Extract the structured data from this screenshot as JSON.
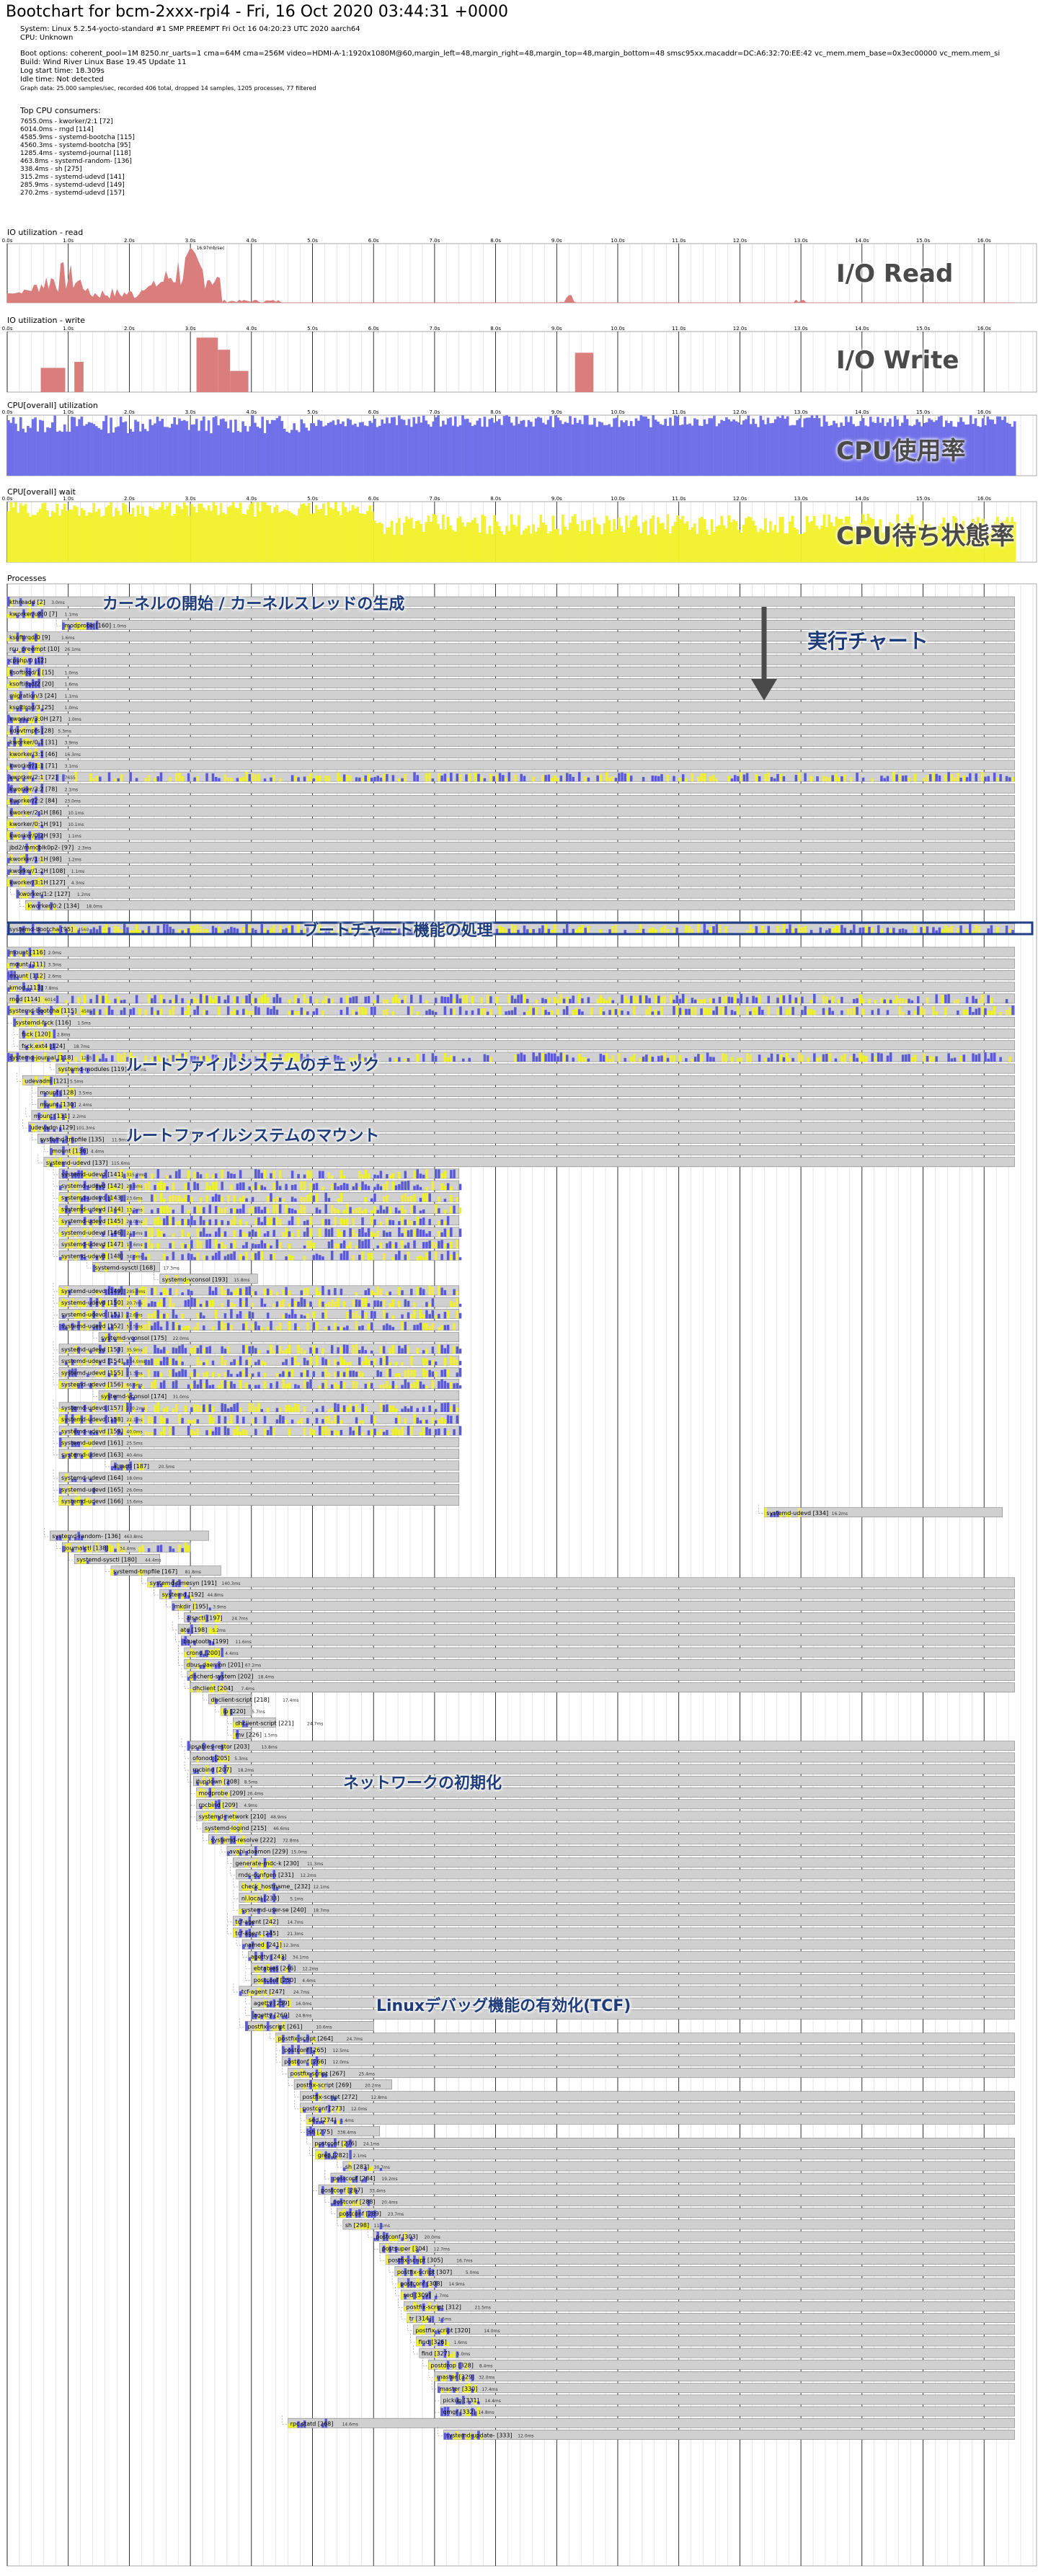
{
  "header": {
    "title": "Bootchart for bcm-2xxx-rpi4 - Fri, 16 Oct 2020 03:44:31 +0000",
    "system": "System: Linux 5.2.54-yocto-standard #1 SMP PREEMPT Fri Oct 16 04:20:23 UTC 2020 aarch64",
    "cpu": "CPU: Unknown",
    "boot_options": "Boot options: coherent_pool=1M 8250.nr_uarts=1 cma=64M cma=256M video=HDMI-A-1:1920x1080M@60,margin_left=48,margin_right=48,margin_top=48,margin_bottom=48 smsc95xx.macaddr=DC:A6:32:70:EE:42 vc_mem.mem_base=0x3ec00000 vc_mem.mem_si",
    "build": "Build: Wind River Linux Base 19.45 Update 11",
    "log_start": "Log start time: 18.309s",
    "idle_time": "Idle time: Not detected",
    "graph_data": "Graph data: 25.000 samples/sec, recorded 406 total, dropped 14 samples, 1205 processes, 77 filtered"
  },
  "top_cpu": {
    "title": "Top CPU consumers:",
    "lines": [
      "7655.0ms - kworker/2:1 [72]",
      "6014.0ms - rngd [114]",
      "4585.9ms - systemd-bootcha [115]",
      "4560.3ms - systemd-bootcha [95]",
      "1285.4ms - systemd-journal [118]",
      "463.8ms - systemd-random- [136]",
      "338.4ms - sh [275]",
      "315.2ms - systemd-udevd [141]",
      "285.9ms - systemd-udevd [149]",
      "270.2ms - systemd-udevd [157]"
    ]
  },
  "time_axis": [
    "0.0s",
    "1.0s",
    "2.0s",
    "3.0s",
    "4.0s",
    "5.0s",
    "6.0s",
    "7.0s",
    "8.0s",
    "9.0s",
    "10.0s",
    "11.0s",
    "12.0s",
    "13.0s",
    "14.0s",
    "15.0s",
    "16.0s"
  ],
  "charts": {
    "io_read": {
      "title": "IO utilization - read",
      "overlay": "I/O Read",
      "peak": "16.97mb/sec"
    },
    "io_write": {
      "title": "IO utilization - write",
      "overlay": "I/O Write"
    },
    "cpu_util": {
      "title": "CPU[overall] utilization",
      "overlay": "CPU使用率"
    },
    "cpu_wait": {
      "title": "CPU[overall] wait",
      "overlay": "CPU待ち状態率"
    }
  },
  "colors": {
    "io": "#d97d7d",
    "cpu": "#7070e8",
    "wait": "#f2f232",
    "proc_bg": "#d0d0d0",
    "proc_border": "#808080",
    "proc_cpu": "#5a5ad8",
    "proc_wait": "#f0f030",
    "annot": "#1f3c7a",
    "box": "#1e3f8a"
  },
  "processes_title": "Processes",
  "annotations": {
    "kernel": "カーネルの開始 / カーネルスレッドの生成",
    "exec_chart": "実行チャート",
    "bootchart": "ブートチャート機能の処理",
    "fscheck": "ルートファイルシステムのチェック",
    "mount": "ルートファイルシステムのマウント",
    "network": "ネットワークの初期化",
    "tcf": "Linuxデバッグ機能の有効化(TCF)"
  },
  "processes": [
    [
      "kthreadd [2]",
      0.0,
      16.5,
      "3.0ms"
    ],
    [
      "kworker/u8:0 [7]",
      0.0,
      16.5,
      "1.1ms"
    ],
    [
      "modprobe [160]",
      0.9,
      16.5,
      "1.0ms"
    ],
    [
      "ksoftirqd/0 [9]",
      0.0,
      16.5,
      "1.6ms"
    ],
    [
      "rcu_preempt [10]",
      0.0,
      16.5,
      "26.1ms"
    ],
    [
      "cpuhp/0 [12]",
      0.0,
      16.5,
      ""
    ],
    [
      "ksoftirqd/1 [15]",
      0.0,
      16.5,
      "1.0ms"
    ],
    [
      "ksoftirqd/2 [20]",
      0.0,
      16.5,
      "1.6ms"
    ],
    [
      "migration/3 [24]",
      0.0,
      16.5,
      "1.1ms"
    ],
    [
      "ksoftirqd/3 [25]",
      0.0,
      16.5,
      "1.0ms"
    ],
    [
      "kworker/3:0H [27]",
      0.0,
      16.5,
      "1.0ms"
    ],
    [
      "kdevtmpfs [28]",
      0.0,
      16.5,
      "5.3ms"
    ],
    [
      "kworker/0:1 [31]",
      0.0,
      16.5,
      "3.9ms"
    ],
    [
      "kworker/3:1 [46]",
      0.0,
      16.5,
      "16.3ms"
    ],
    [
      "kworker/1:1 [71]",
      0.0,
      16.5,
      "3.1ms"
    ],
    [
      "kworker/2:1 [72]",
      0.0,
      16.5,
      "7655"
    ],
    [
      "kworker/3:2 [78]",
      0.0,
      16.5,
      "2.1ms"
    ],
    [
      "kworker/2:2 [84]",
      0.0,
      16.5,
      "23.0ms"
    ],
    [
      "kworker/2:1H [86]",
      0.0,
      16.5,
      "10.1ms"
    ],
    [
      "kworker/0:1H [91]",
      0.0,
      16.5,
      "10.1ms"
    ],
    [
      "kworker/0:2H [93]",
      0.0,
      16.5,
      "1.1ms"
    ],
    [
      "jbd2/mmcblk0p2- [97]",
      0.0,
      16.5,
      "2.3ms"
    ],
    [
      "kworker/1:1H [98]",
      0.0,
      16.5,
      "1.2ms"
    ],
    [
      "kworker/1:2H [108]",
      0.0,
      16.5,
      "1.1ms"
    ],
    [
      "kworker/3:1H [127]",
      0.0,
      16.5,
      "4.3ms"
    ],
    [
      "kworker/1:2 [127]",
      0.15,
      16.5,
      "1.2ms"
    ],
    [
      "kworker/0:2 [134]",
      0.3,
      16.5,
      "18.0ms"
    ],
    [
      "",
      0,
      0,
      ""
    ],
    [
      "systemd-bootcha [95]",
      0.0,
      16.5,
      "4560"
    ],
    [
      "",
      0,
      0,
      ""
    ],
    [
      "mount [116]",
      0.0,
      16.5,
      "2.0ms"
    ],
    [
      "mount [111]",
      0.0,
      16.5,
      "3.3ms"
    ],
    [
      "mount [112]",
      0.0,
      16.5,
      "2.6ms"
    ],
    [
      "kmod [113]",
      0.0,
      16.5,
      "7.8ms"
    ],
    [
      "rngd [114]",
      0.0,
      16.5,
      "6014"
    ],
    [
      "systemd-bootcha [115]",
      0.0,
      16.5,
      "4585"
    ],
    [
      "systemd-fsck [116]",
      0.1,
      16.5,
      "1.5ms"
    ],
    [
      "fsck [120]",
      0.2,
      16.5,
      "2.8ms"
    ],
    [
      "fsck.ext4 [124]",
      0.2,
      16.5,
      "18.7ms"
    ],
    [
      "systemd-journal [118]",
      0.0,
      16.5,
      "1285"
    ],
    [
      "systemd-modules [119]",
      0.8,
      16.5,
      "14.9ms"
    ],
    [
      "udevadm [121]",
      0.25,
      16.5,
      "5.5ms"
    ],
    [
      "mount [128]",
      0.5,
      16.5,
      "3.5ms"
    ],
    [
      "mount [130]",
      0.5,
      16.5,
      "2.4ms"
    ],
    [
      "mount [131]",
      0.4,
      16.5,
      "2.2ms"
    ],
    [
      "udevadm [129]",
      0.35,
      16.5,
      "101.3ms"
    ],
    [
      "systemd-tmpfile [135]",
      0.5,
      16.5,
      "11.9ms"
    ],
    [
      "mount [136]",
      0.7,
      16.5,
      "4.4ms"
    ],
    [
      "systemd-udevd [137]",
      0.6,
      16.5,
      "115.6ms"
    ],
    [
      "systemd-udevd [141]",
      0.85,
      7.4,
      "315.2ms"
    ],
    [
      "systemd-udevd [142]",
      0.85,
      7.4,
      "26.8ms"
    ],
    [
      "systemd-udevd [143]",
      0.85,
      7.4,
      "23.6ms"
    ],
    [
      "systemd-udevd [144]",
      0.85,
      7.4,
      "13.5ms"
    ],
    [
      "systemd-udevd [145]",
      0.85,
      7.4,
      "20.0ms"
    ],
    [
      "systemd-udevd [146]",
      0.85,
      7.4,
      "21.5ms"
    ],
    [
      "systemd-udevd [147]",
      0.85,
      7.4,
      "17.6ms"
    ],
    [
      "systemd-udevd [148]",
      0.85,
      7.4,
      "34.0ms"
    ],
    [
      "systemd-sysctl [168]",
      1.4,
      2.5,
      "17.3ms"
    ],
    [
      "systemd-vconsol [193]",
      2.5,
      4.1,
      "15.8ms"
    ],
    [
      "systemd-udevd [149]",
      0.85,
      7.4,
      "285.9ms"
    ],
    [
      "systemd-udevd [150]",
      0.85,
      7.4,
      "20.7ms"
    ],
    [
      "systemd-udevd [151]",
      0.85,
      7.4,
      "22.6ms"
    ],
    [
      "systemd-udevd [152]",
      0.85,
      7.4,
      "57.5ms"
    ],
    [
      "systemd-vconsol [175]",
      1.5,
      7.4,
      "22.0ms"
    ],
    [
      "systemd-udevd [153]",
      0.85,
      7.4,
      "35.9ms"
    ],
    [
      "systemd-udevd [154]",
      0.85,
      7.4,
      "134.0ms"
    ],
    [
      "systemd-udevd [155]",
      0.85,
      7.4,
      "21.3ms"
    ],
    [
      "systemd-udevd [156]",
      0.85,
      7.4,
      "66.6ms"
    ],
    [
      "systemd-vconsol [174]",
      1.5,
      7.4,
      "31.0ms"
    ],
    [
      "systemd-udevd [157]",
      0.85,
      7.4,
      "270.2ms"
    ],
    [
      "systemd-udevd [158]",
      0.85,
      7.4,
      "22.1ms"
    ],
    [
      "systemd-udevd [159]",
      0.85,
      7.4,
      "40.0ms"
    ],
    [
      "systemd-udevd [161]",
      0.85,
      7.4,
      "25.5ms"
    ],
    [
      "systemd-udevd [163]",
      0.85,
      7.4,
      "40.4ms"
    ],
    [
      "alsactl [187]",
      1.7,
      7.4,
      "20.5ms"
    ],
    [
      "systemd-udevd [164]",
      0.85,
      7.4,
      "18.0ms"
    ],
    [
      "systemd-udevd [165]",
      0.85,
      7.4,
      "26.0ms"
    ],
    [
      "systemd-udevd [166]",
      0.85,
      7.4,
      "15.6ms"
    ],
    [
      "systemd-udevd [334]",
      12.4,
      16.3,
      "16.2ms"
    ],
    [
      "",
      0,
      0,
      ""
    ],
    [
      "systemd-random- [136]",
      0.7,
      3.3,
      "463.8ms"
    ],
    [
      "journalctl [138]",
      0.9,
      3.0,
      "34.4ms"
    ],
    [
      "systemd-sysctl [180]",
      1.1,
      2.5,
      "44.4ms"
    ],
    [
      "systemd-tmpfile [167]",
      1.7,
      3.5,
      "81.8ms"
    ],
    [
      "systemd-timesyn [191]",
      2.3,
      16.5,
      "140.3ms"
    ],
    [
      "systemd [192]",
      2.5,
      16.5,
      "44.8ms"
    ],
    [
      "mkdir [195]",
      2.7,
      16.5,
      "3.9ms"
    ],
    [
      "alsactl [197]",
      2.9,
      16.5,
      "24.7ms"
    ],
    [
      "atd [198]",
      2.8,
      16.5,
      "5.2ms"
    ],
    [
      "bluetooth [199]",
      2.85,
      16.5,
      "11.6ms"
    ],
    [
      "crond [200]",
      2.9,
      16.5,
      "4.4ms"
    ],
    [
      "dbus-daemon [201]",
      2.9,
      16.5,
      "67.2ms"
    ],
    [
      "dhcherd-system [202]",
      2.95,
      16.5,
      "18.4ms"
    ],
    [
      "dhclient [204]",
      3.0,
      16.5,
      "7.4ms"
    ],
    [
      "dhclient-script [218]",
      3.3,
      4.0,
      "17.4ms"
    ],
    [
      "ip [220]",
      3.5,
      4.0,
      "5.7ms"
    ],
    [
      "dhclient-script [221]",
      3.7,
      4.4,
      "24.7ms"
    ],
    [
      "mv [226]",
      3.7,
      4.0,
      "1.5ms"
    ],
    [
      "ipsables-restor [203]",
      2.95,
      16.5,
      "13.8ms"
    ],
    [
      "ofonod [205]",
      3.0,
      16.5,
      "5.3ms"
    ],
    [
      "rpcbind [207]",
      3.0,
      16.5,
      "18.2ms"
    ],
    [
      "ifupdown [208]",
      3.05,
      16.5,
      "8.5ms"
    ],
    [
      "modprobe [209]",
      3.1,
      16.5,
      "26.4ms"
    ],
    [
      "rpcbind [209]",
      3.1,
      16.5,
      "4.9ms"
    ],
    [
      "systemd-network [210]",
      3.1,
      16.5,
      "48.9ms"
    ],
    [
      "systemd-logind [215]",
      3.2,
      16.5,
      "46.6ms"
    ],
    [
      "systemd-resolve [222]",
      3.3,
      16.5,
      "72.8ms"
    ],
    [
      "avahi-daemon [229]",
      3.6,
      16.5,
      "15.0ms"
    ],
    [
      "generate-rndc-k [230]",
      3.7,
      16.5,
      "11.3ms"
    ],
    [
      "rndc-confgen [231]",
      3.75,
      16.5,
      "12.2ms"
    ],
    [
      "check_hostname_ [232]",
      3.8,
      16.5,
      "12.1ms"
    ],
    [
      "nl.local [233]",
      3.8,
      16.5,
      "5.1ms"
    ],
    [
      "systemd-user-se [240]",
      3.8,
      16.5,
      "18.7ms"
    ],
    [
      "tcf-agent [242]",
      3.7,
      16.5,
      "14.7ms"
    ],
    [
      "tcf-agent [245]",
      3.7,
      16.5,
      "21.3ms"
    ],
    [
      "named [241]",
      3.85,
      16.5,
      "12.3ms"
    ],
    [
      "agetty [243]",
      3.95,
      16.5,
      "34.1ms"
    ],
    [
      "ebtables [246]",
      4.0,
      16.5,
      "12.2ms"
    ],
    [
      "postconf [250]",
      4.0,
      16.5,
      "4.4ms"
    ],
    [
      "tcf-agent [247]",
      3.8,
      16.5,
      "24.7ms"
    ],
    [
      "agetty [259]",
      4.0,
      16.5,
      "16.0ms"
    ],
    [
      "agetty [260]",
      4.0,
      16.5,
      "24.8ms"
    ],
    [
      "postfix-script [261]",
      3.9,
      6.0,
      "10.6ms"
    ],
    [
      "postfix-script [264]",
      4.4,
      16.5,
      "24.7ms"
    ],
    [
      "postconf [265]",
      4.5,
      16.5,
      "12.5ms"
    ],
    [
      "postconf [266]",
      4.5,
      16.5,
      "12.0ms"
    ],
    [
      "postfix-script [267]",
      4.6,
      16.5,
      "25.4ms"
    ],
    [
      "postfix-script [269]",
      4.7,
      6.3,
      "20.2ms"
    ],
    [
      "postfix-script [272]",
      4.8,
      16.5,
      "12.8ms"
    ],
    [
      "postconf [273]",
      4.8,
      16.5,
      "12.0ms"
    ],
    [
      "sed [274]",
      4.9,
      16.5,
      "1.4ms"
    ],
    [
      "sh [275]",
      4.9,
      6.1,
      "338.4ms"
    ],
    [
      "postconf [276]",
      5.0,
      16.5,
      "24.1ms"
    ],
    [
      "grep [282]",
      5.05,
      16.5,
      "2.1ms"
    ],
    [
      "sh [283]",
      5.5,
      16.5,
      "30.7ms"
    ],
    [
      "postconf [284]",
      5.3,
      16.5,
      "19.2ms"
    ],
    [
      "postconf [287]",
      5.1,
      16.5,
      "33.4ms"
    ],
    [
      "postconf [288]",
      5.3,
      16.5,
      "20.4ms"
    ],
    [
      "postconf [289]",
      5.4,
      16.5,
      "23.7ms"
    ],
    [
      "sh [298]",
      5.5,
      16.5,
      "11.1ms"
    ],
    [
      "postconf [303]",
      6.0,
      16.5,
      "20.0ms"
    ],
    [
      "postsuper [304]",
      6.1,
      16.5,
      "12.7ms"
    ],
    [
      "postfix-script [305]",
      6.2,
      16.5,
      "16.7ms"
    ],
    [
      "postfix-script [307]",
      6.35,
      16.5,
      "5.0ms"
    ],
    [
      "postconf [308]",
      6.4,
      16.5,
      "14.9ms"
    ],
    [
      "sed [309]",
      6.45,
      16.5,
      "1.7ms"
    ],
    [
      "postfix-script [312]",
      6.5,
      16.5,
      "21.5ms"
    ],
    [
      "tr [314]",
      6.55,
      16.5,
      "1.5ms"
    ],
    [
      "postfix-script [320]",
      6.65,
      16.5,
      "14.0ms"
    ],
    [
      "find [326]",
      6.7,
      16.5,
      "1.6ms"
    ],
    [
      "find [327]",
      6.75,
      16.5,
      "5.0ms"
    ],
    [
      "postdrop [328]",
      6.9,
      16.5,
      "8.4ms"
    ],
    [
      "master [329]",
      7.0,
      16.5,
      "32.0ms"
    ],
    [
      "master [330]",
      7.05,
      16.5,
      "17.4ms"
    ],
    [
      "pickup [331]",
      7.1,
      16.5,
      "14.4ms"
    ],
    [
      "qmgr [332]",
      7.1,
      16.5,
      "14.8ms"
    ],
    [
      "rpc.statd [268]",
      4.6,
      16.5,
      "14.6ms"
    ],
    [
      "systemd-update- [333]",
      7.15,
      16.5,
      "12.0ms"
    ]
  ]
}
